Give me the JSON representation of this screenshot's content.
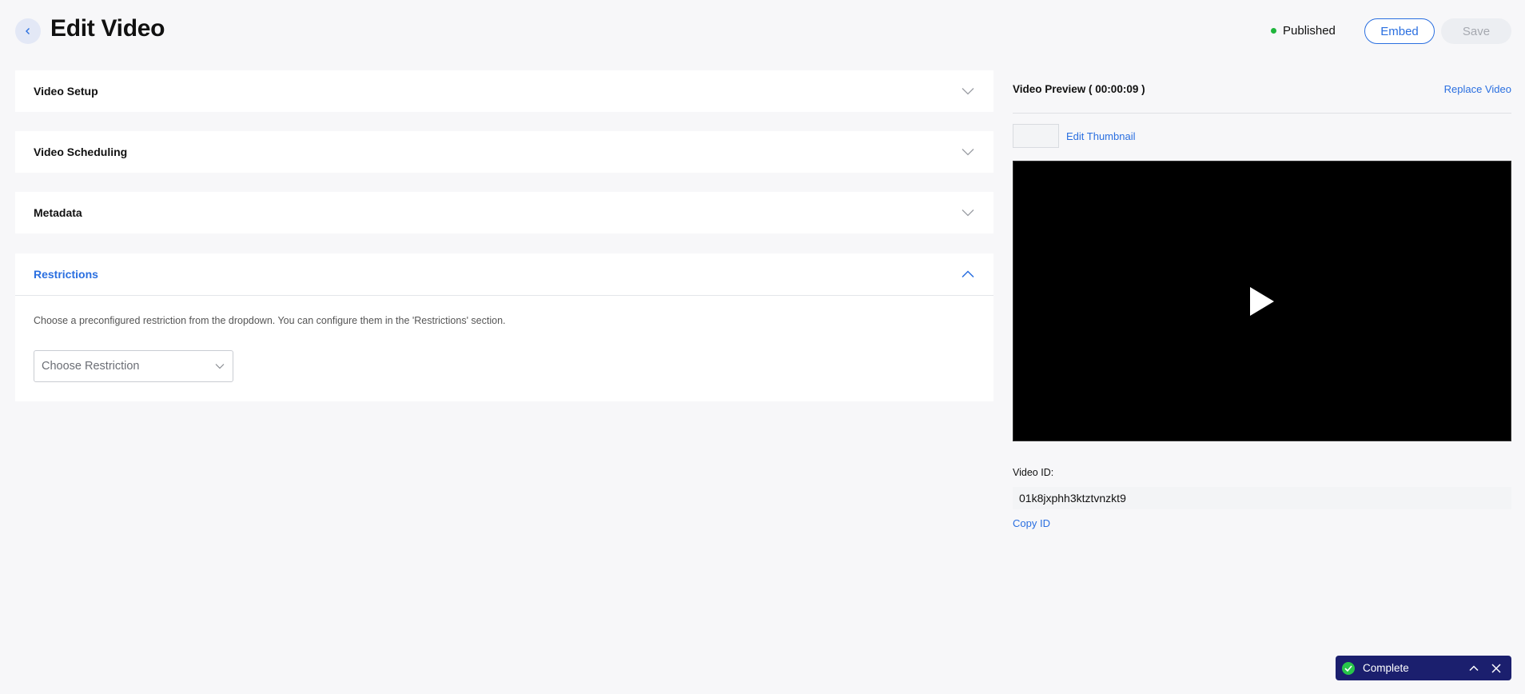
{
  "header": {
    "title": "Edit Video",
    "status": "Published",
    "status_color": "#1fb53c",
    "embed_label": "Embed",
    "save_label": "Save"
  },
  "sections": [
    {
      "title": "Video Setup",
      "expanded": false,
      "icon": "chevron-down-icon"
    },
    {
      "title": "Video Scheduling",
      "expanded": false,
      "icon": "chevron-down-icon"
    },
    {
      "title": "Metadata",
      "expanded": false,
      "icon": "chevron-down-icon"
    },
    {
      "title": "Restrictions",
      "expanded": true,
      "icon": "chevron-up-icon"
    }
  ],
  "restrictions": {
    "help_text": "Choose a preconfigured restriction from the dropdown. You can configure them in the 'Restrictions' section.",
    "select_placeholder": "Choose Restriction"
  },
  "preview": {
    "title": "Video Preview ( 00:00:09 )",
    "replace_label": "Replace Video",
    "edit_thumbnail_label": "Edit Thumbnail",
    "video_id_label": "Video ID:",
    "video_id": "01k8jxphh3ktztvnzkt9",
    "copy_id_label": "Copy ID"
  },
  "toast": {
    "label": "Complete",
    "icons": [
      "check-icon",
      "chevron-up-icon",
      "close-icon"
    ]
  },
  "colors": {
    "accent": "#2a6fe0",
    "toast_bg": "#1b1f6e",
    "success": "#28c64a"
  }
}
